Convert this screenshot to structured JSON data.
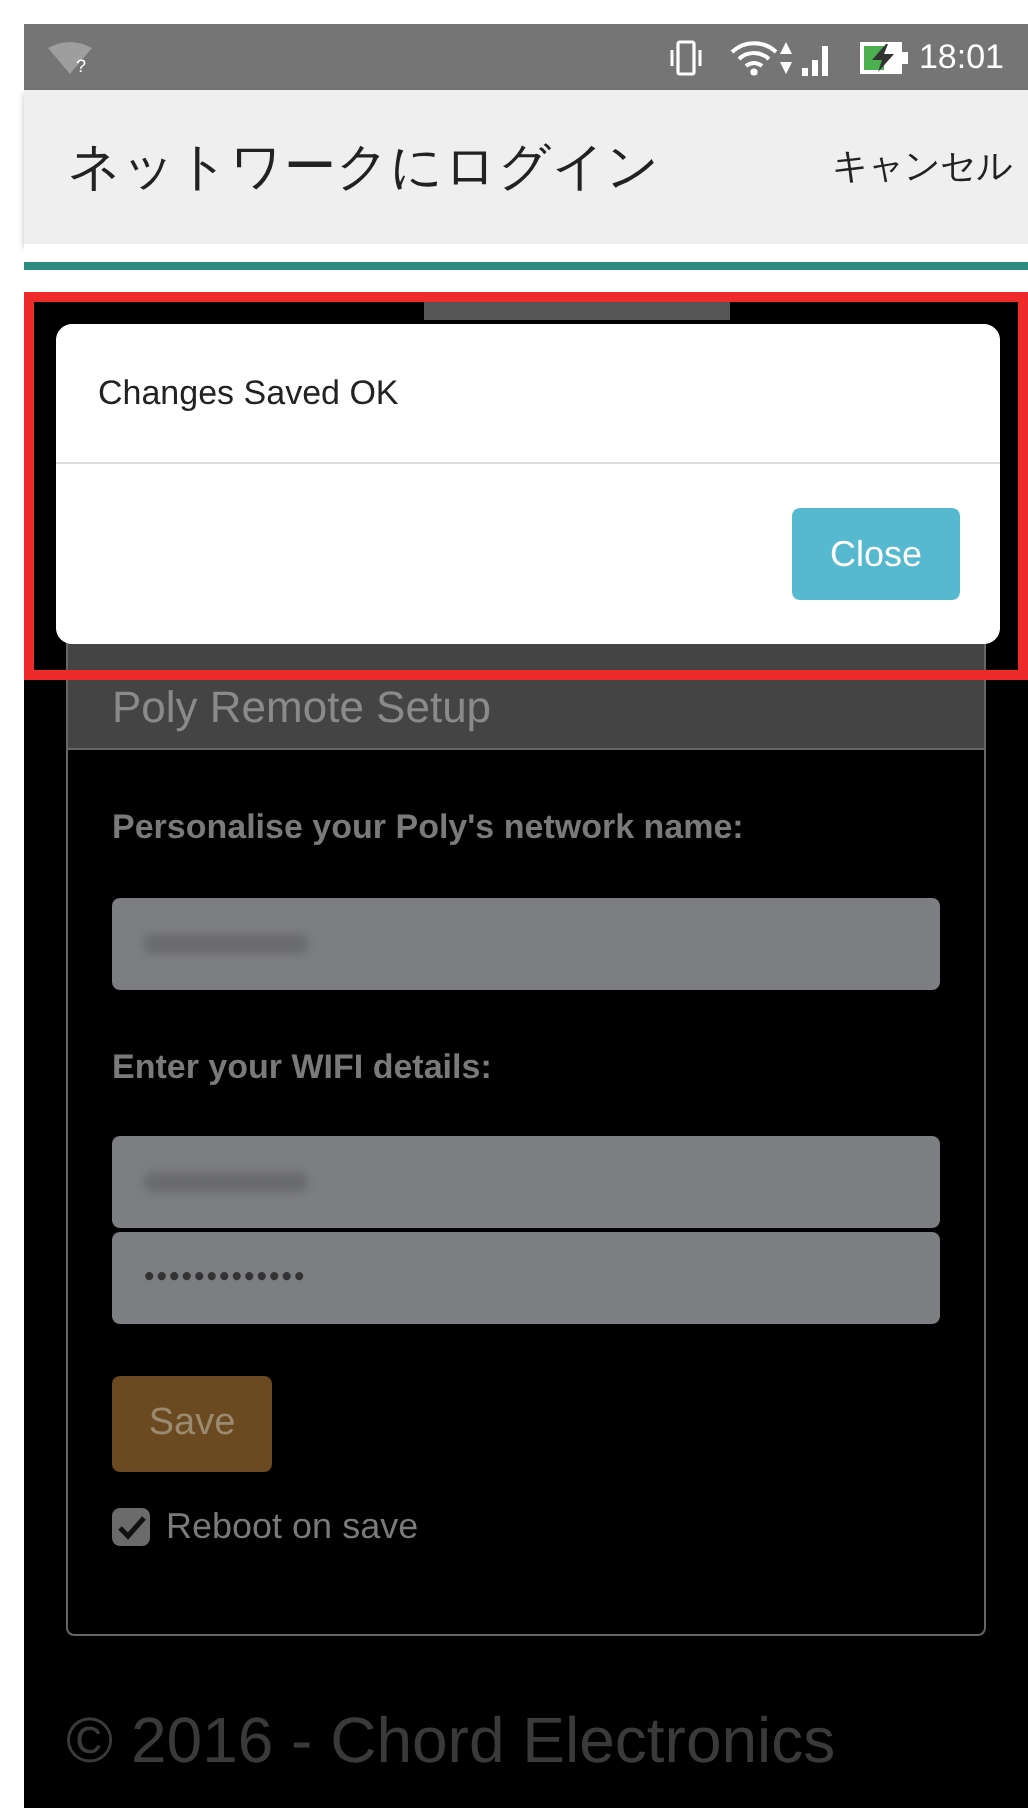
{
  "status_bar": {
    "wifi_badge": "?",
    "time": "18:01",
    "battery_charging": true
  },
  "app_bar": {
    "title": "ネットワークにログイン",
    "cancel": "キャンセル"
  },
  "panel": {
    "heading": "Poly Remote Setup",
    "sections": [
      {
        "label": "Personalise your Poly's network name:",
        "fields": [
          {
            "kind": "blurred"
          }
        ]
      },
      {
        "label": "Enter your WIFI details:",
        "fields": [
          {
            "kind": "blurred"
          },
          {
            "kind": "password",
            "value": "•••••••••••••"
          }
        ]
      }
    ],
    "save_button": "Save",
    "reboot": {
      "label": "Reboot on save",
      "checked": true
    }
  },
  "footer": "© 2016 - Chord Electronics",
  "dialog": {
    "message": "Changes Saved OK",
    "close_button": "Close"
  }
}
